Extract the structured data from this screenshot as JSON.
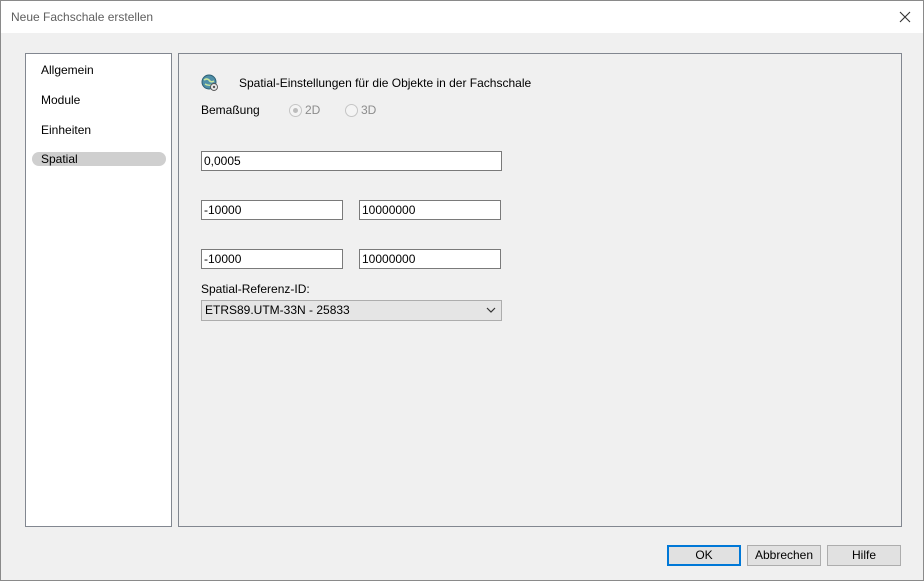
{
  "window": {
    "title": "Neue Fachschale erstellen",
    "close_icon": "close-icon"
  },
  "sidebar": {
    "items": [
      {
        "label": "Allgemein",
        "selected": false
      },
      {
        "label": "Module",
        "selected": false
      },
      {
        "label": "Einheiten",
        "selected": false
      },
      {
        "label": "Spatial",
        "selected": true
      }
    ]
  },
  "spatial": {
    "header": "Spatial-Einstellungen für die Objekte in der Fachschale",
    "header_icon": "globe-settings-icon",
    "dimension_label": "Bemaßung",
    "radio_2d": "2D",
    "radio_3d": "3D",
    "dimension_selected": "2D",
    "tolerance": "0,0005",
    "x_min": "-10000",
    "x_max": "10000000",
    "y_min": "-10000",
    "y_max": "10000000",
    "reference_label": "Spatial-Referenz-ID:",
    "reference_value": "ETRS89.UTM-33N - 25833"
  },
  "footer": {
    "ok_label": "OK",
    "cancel_label": "Abbrechen",
    "help_label": "Hilfe"
  },
  "colors": {
    "accent": "#0078d7",
    "selection": "#cfcfcf"
  }
}
